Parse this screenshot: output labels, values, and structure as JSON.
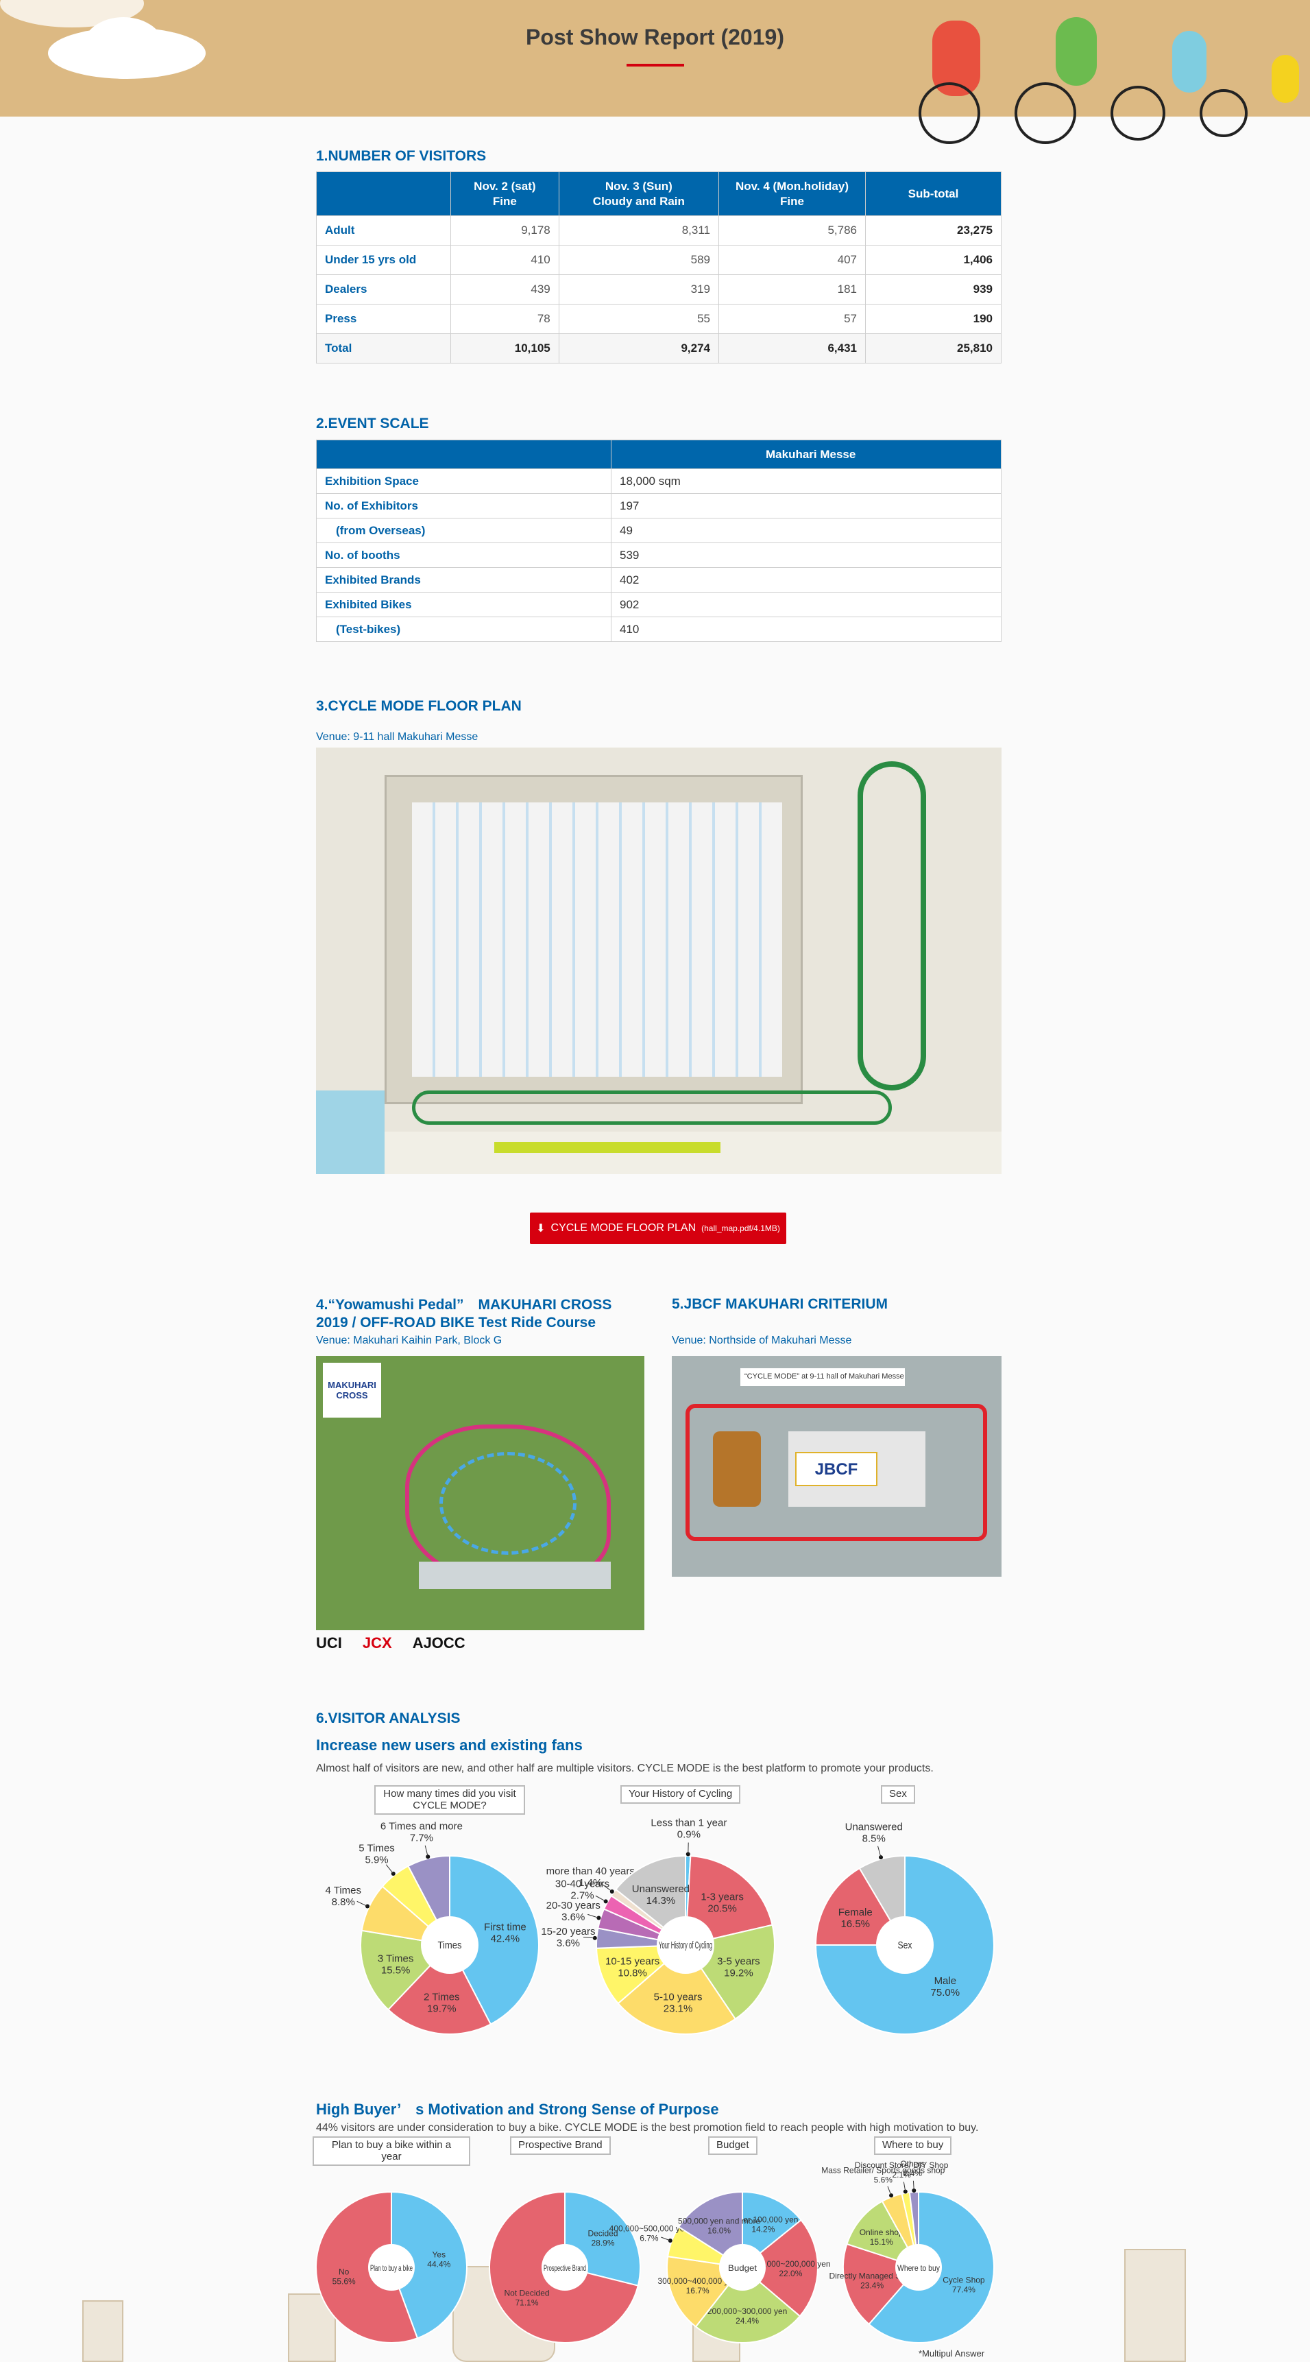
{
  "header": {
    "title": "Post Show Report (2019)"
  },
  "visitors": {
    "heading": "1.NUMBER OF VISITORS",
    "columns": [
      {
        "line1": "Nov. 2 (sat)",
        "line2": "Fine"
      },
      {
        "line1": "Nov. 3 (Sun)",
        "line2": "Cloudy and Rain"
      },
      {
        "line1": "Nov. 4 (Mon.holiday)",
        "line2": "Fine"
      },
      {
        "line1": "Sub-total",
        "line2": ""
      }
    ],
    "rows": [
      {
        "label": "Adult",
        "values": [
          "9,178",
          "8,311",
          "5,786",
          "23,275"
        ]
      },
      {
        "label": "Under 15 yrs old",
        "values": [
          "410",
          "589",
          "407",
          "1,406"
        ]
      },
      {
        "label": "Dealers",
        "values": [
          "439",
          "319",
          "181",
          "939"
        ]
      },
      {
        "label": "Press",
        "values": [
          "78",
          "55",
          "57",
          "190"
        ]
      },
      {
        "label": "Total",
        "values": [
          "10,105",
          "9,274",
          "6,431",
          "25,810"
        ]
      }
    ]
  },
  "scale": {
    "heading": "2.EVENT SCALE",
    "column": "Makuhari Messe",
    "rows": [
      {
        "label": "Exhibition Space",
        "value": "18,000 sqm"
      },
      {
        "label": "No. of Exhibitors",
        "value": "197"
      },
      {
        "label": "(from Overseas)",
        "value": "49"
      },
      {
        "label": "No. of booths",
        "value": "539"
      },
      {
        "label": "Exhibited Brands",
        "value": "402"
      },
      {
        "label": "Exhibited Bikes",
        "value": "902"
      },
      {
        "label": "(Test-bikes)",
        "value": "410"
      }
    ]
  },
  "floor": {
    "heading": "3.CYCLE MODE FLOOR PLAN",
    "venue": "Venue: 9-11 hall Makuhari Messe",
    "download_label": "CYCLE MODE FLOOR PLAN",
    "download_file": "(hall_map.pdf/4.1MB)"
  },
  "cross": {
    "heading_line1": "4.“Yowamushi Pedal”　MAKUHARI CROSS",
    "heading_line2": "2019 / OFF-ROAD BIKE Test Ride Course",
    "venue": "Venue: Makuhari Kaihin Park, Block G",
    "map_logo": "MAKUHARI CROSS",
    "sponsor_logos": [
      "UCI",
      "JCX",
      "AJOCC"
    ]
  },
  "criterium": {
    "heading": "5.JBCF MAKUHARI CRITERIUM",
    "venue": "Venue: Northside of Makuhari Messe",
    "map_caption": "“CYCLE MODE” at 9-11 hall of Makuhari Messe",
    "map_logo": "JBCF"
  },
  "analysis": {
    "heading": "6.VISITOR ANALYSIS",
    "sub1": "Increase new users and existing fans",
    "lead1": "Almost half of visitors are new, and other half are multiple visitors. CYCLE MODE is the best platform to promote your products.",
    "sub2": "High Buyer’　s Motivation and Strong Sense of Purpose",
    "lead2": "44% visitors are under consideration to buy a bike. CYCLE MODE is the best promotion field to reach people with high motivation to buy.",
    "footnote": "*Multipul Answer"
  },
  "colors": {
    "accent": "#0062a8",
    "header_bg": "#0066ab",
    "button": "#d6000f",
    "blue": "#64c5f0",
    "red": "#e5646e",
    "green": "#bddb76",
    "gold": "#fddc6a",
    "yellow": "#fff568",
    "purple": "#9a91c5",
    "gray": "#c9c9c9"
  },
  "chart_data": [
    {
      "type": "pie",
      "title": "How many times did you visit CYCLE MODE?",
      "center": "Times",
      "slices": [
        {
          "label": "First time",
          "value": 42.4,
          "color": "#64c5f0"
        },
        {
          "label": "2 Times",
          "value": 19.7,
          "color": "#e5646e"
        },
        {
          "label": "3 Times",
          "value": 15.5,
          "color": "#bddb76"
        },
        {
          "label": "4 Times",
          "value": 8.8,
          "color": "#fddc6a"
        },
        {
          "label": "5 Times",
          "value": 5.9,
          "color": "#fff568"
        },
        {
          "label": "6 Times and more",
          "value": 7.7,
          "color": "#9a91c5"
        }
      ]
    },
    {
      "type": "pie",
      "title": "Your History of Cycling",
      "center": "Your History of Cycling",
      "slices": [
        {
          "label": "Less than 1 year",
          "value": 0.9,
          "color": "#64c5f0"
        },
        {
          "label": "1-3 years",
          "value": 20.5,
          "color": "#e5646e"
        },
        {
          "label": "3-5 years",
          "value": 19.2,
          "color": "#bddb76"
        },
        {
          "label": "5-10 years",
          "value": 23.1,
          "color": "#fddc6a"
        },
        {
          "label": "10-15 years",
          "value": 10.8,
          "color": "#fff568"
        },
        {
          "label": "15-20 years",
          "value": 3.6,
          "color": "#9a91c5"
        },
        {
          "label": "20-30 years",
          "value": 3.6,
          "color": "#b86bb5"
        },
        {
          "label": "30-40 years",
          "value": 2.7,
          "color": "#ec63b2"
        },
        {
          "label": "more than 40 years",
          "value": 1.4,
          "color": "#efe0cf"
        },
        {
          "label": "Unanswered",
          "value": 14.3,
          "color": "#c9c9c9"
        }
      ]
    },
    {
      "type": "pie",
      "title": "Sex",
      "center": "Sex",
      "slices": [
        {
          "label": "Male",
          "value": 75.0,
          "color": "#64c5f0"
        },
        {
          "label": "Female",
          "value": 16.5,
          "color": "#e5646e"
        },
        {
          "label": "Unanswered",
          "value": 8.5,
          "color": "#c9c9c9"
        }
      ]
    },
    {
      "type": "pie",
      "title": "Plan to buy a bike within a year",
      "center": "Plan to buy a bike",
      "slices": [
        {
          "label": "Yes",
          "value": 44.4,
          "color": "#64c5f0"
        },
        {
          "label": "No",
          "value": 55.6,
          "color": "#e5646e"
        }
      ]
    },
    {
      "type": "pie",
      "title": "Prospective Brand",
      "center": "Prospective Brand",
      "slices": [
        {
          "label": "Decided",
          "value": 28.9,
          "color": "#64c5f0"
        },
        {
          "label": "Not Decided",
          "value": 71.1,
          "color": "#e5646e"
        }
      ]
    },
    {
      "type": "pie",
      "title": "Budget",
      "center": "Budget",
      "slices": [
        {
          "label": "Under 100,000 yen",
          "value": 14.2,
          "color": "#64c5f0"
        },
        {
          "label": "100,000~200,000 yen",
          "value": 22.0,
          "color": "#e5646e"
        },
        {
          "label": "200,000~300,000 yen",
          "value": 24.4,
          "color": "#bddb76"
        },
        {
          "label": "300,000~400,000 yen",
          "value": 16.7,
          "color": "#fddc6a"
        },
        {
          "label": "400,000~500,000 yen",
          "value": 6.7,
          "color": "#fff568"
        },
        {
          "label": "500,000 yen and more",
          "value": 16.0,
          "color": "#9a91c5"
        }
      ]
    },
    {
      "type": "pie",
      "title": "Where to buy",
      "center": "Where to buy",
      "note": "*Multipul Answer",
      "slices": [
        {
          "label": "Cycle Shop",
          "value": 77.4,
          "color": "#64c5f0"
        },
        {
          "label": "Directly Managed Store",
          "value": 23.4,
          "color": "#e5646e"
        },
        {
          "label": "Online shop",
          "value": 15.1,
          "color": "#bddb76"
        },
        {
          "label": "Mass Retailer/ Sports goods shop",
          "value": 5.6,
          "color": "#fddc6a"
        },
        {
          "label": "Discount Store/ DIY Shop",
          "value": 2.1,
          "color": "#fff568"
        },
        {
          "label": "Others",
          "value": 2.4,
          "color": "#9a91c5"
        }
      ]
    }
  ]
}
